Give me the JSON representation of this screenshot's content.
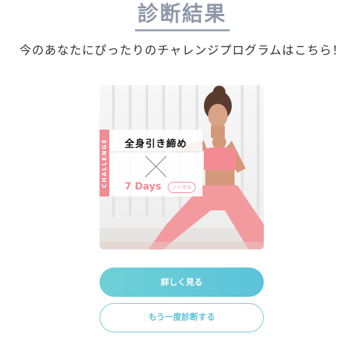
{
  "header": {
    "title": "診断結果",
    "subtitle": "今のあなたにぴったりのチャレンジプログラムはこちら！"
  },
  "result_card": {
    "side_label": "CHALLENGE",
    "course_name": "全身引き締め",
    "duration": "7 Days",
    "level": "ノーマル",
    "colors": {
      "accent_pink": "#f28b94"
    }
  },
  "actions": {
    "details_label": "詳しく見る",
    "retry_label": "もう一度診断する",
    "colors": {
      "primary_gradient_start": "#6ed0d6",
      "primary_gradient_end": "#5cc3da"
    }
  }
}
